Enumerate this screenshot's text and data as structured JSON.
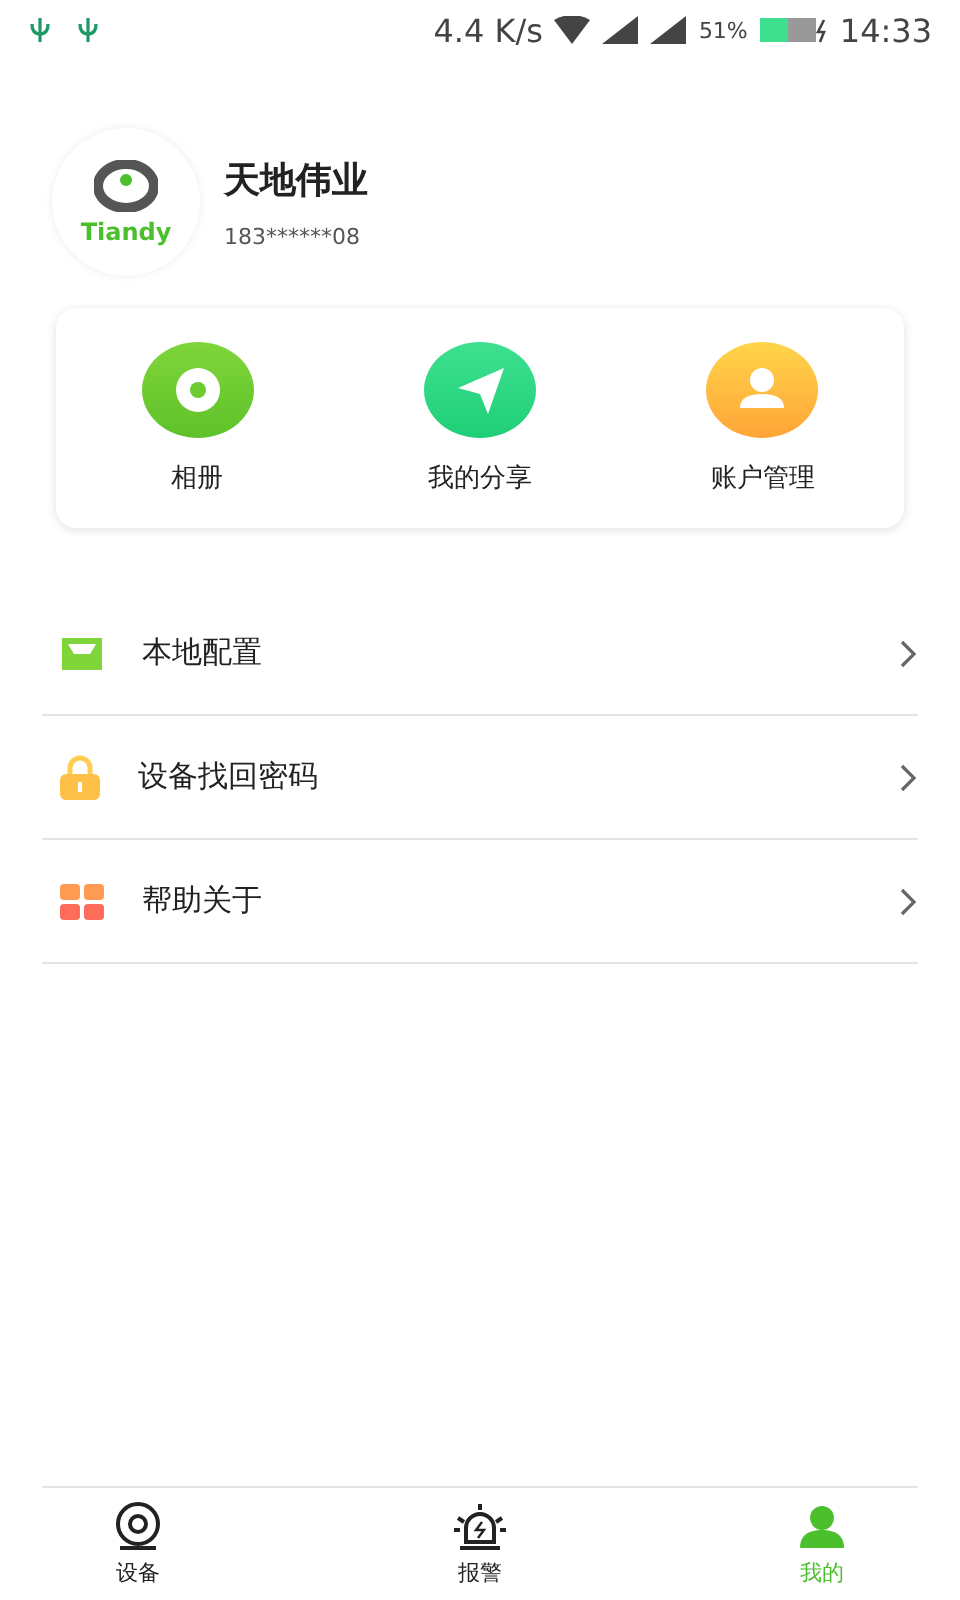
{
  "status_bar": {
    "speed": "4.4 K/s",
    "battery": "51%",
    "time": "14:33"
  },
  "profile": {
    "logo_text": "Tiandy",
    "name": "天地伟业",
    "phone": "183******08"
  },
  "shortcuts": [
    {
      "kind": "album",
      "label": "相册"
    },
    {
      "kind": "share",
      "label": "我的分享"
    },
    {
      "kind": "account",
      "label": "账户管理"
    }
  ],
  "menu": [
    {
      "kind": "inbox",
      "label": "本地配置"
    },
    {
      "kind": "lock",
      "label": "设备找回密码"
    },
    {
      "kind": "grid",
      "label": "帮助关于"
    }
  ],
  "tabs": [
    {
      "kind": "device",
      "label": "设备",
      "selected": false
    },
    {
      "kind": "alarm",
      "label": "报警",
      "selected": false
    },
    {
      "kind": "me",
      "label": "我的",
      "selected": true
    }
  ]
}
